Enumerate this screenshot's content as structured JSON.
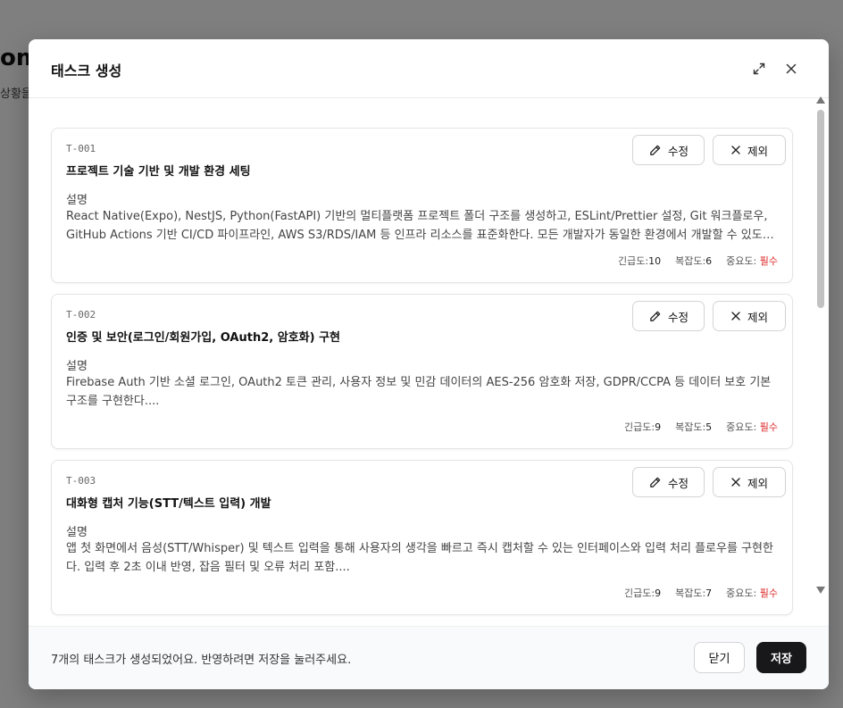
{
  "background": {
    "title_fragment": "om",
    "subtitle_fragment": "상황을"
  },
  "modal": {
    "title": "태스크 생성",
    "edit_label": "수정",
    "exclude_label": "제외",
    "desc_label": "설명",
    "urgency_label": "긴급도:",
    "complexity_label": "복잡도:",
    "importance_label": "중요도:",
    "tasks": [
      {
        "id": "T-001",
        "title": "프로젝트 기술 기반 및 개발 환경 세팅",
        "description": "React Native(Expo), NestJS, Python(FastAPI) 기반의 멀티플랫폼 프로젝트 폴더 구조를 생성하고, ESLint/Prettier 설정, Git 워크플로우, GitHub Actions 기반 CI/CD 파이프라인, AWS S3/RDS/IAM 등 인프라 리소스를 표준화한다. 모든 개발자가 동일한 환경에서 개발할 수 있도록...",
        "urgency": "10",
        "complexity": "6",
        "importance": "필수"
      },
      {
        "id": "T-002",
        "title": "인증 및 보안(로그인/회원가입, OAuth2, 암호화) 구현",
        "description": "Firebase Auth 기반 소셜 로그인, OAuth2 토큰 관리, 사용자 정보 및 민감 데이터의 AES-256 암호화 저장, GDPR/CCPA 등 데이터 보호 기본 구조를 구현한다....",
        "urgency": "9",
        "complexity": "5",
        "importance": "필수"
      },
      {
        "id": "T-003",
        "title": "대화형 캡처 기능(STT/텍스트 입력) 개발",
        "description": "앱 첫 화면에서 음성(STT/Whisper) 및 텍스트 입력을 통해 사용자의 생각을 빠르고 즉시 캡처할 수 있는 인터페이스와 입력 처리 플로우를 구현한다. 입력 후 2초 이내 반영, 잡음 필터 및 오류 처리 포함....",
        "urgency": "9",
        "complexity": "7",
        "importance": "필수"
      }
    ]
  },
  "footer": {
    "message": "7개의 태스크가 생성되었어요. 반영하려면 저장을 눌러주세요.",
    "close_label": "닫기",
    "save_label": "저장"
  },
  "colors": {
    "required": "#dc2626",
    "primary_button": "#18181b"
  }
}
